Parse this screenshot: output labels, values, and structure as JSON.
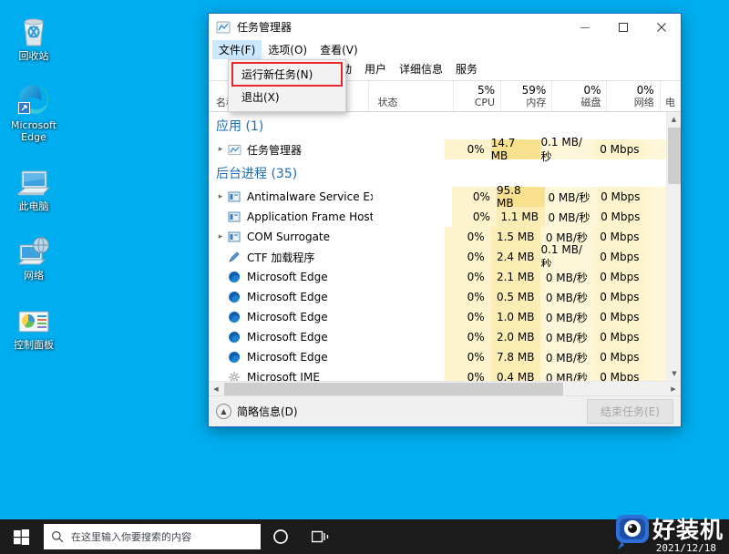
{
  "desktop": {
    "background_color": "#00AEF0",
    "icons": [
      {
        "label": "回收站",
        "icon": "recycle-bin-icon"
      },
      {
        "label": "Microsoft Edge",
        "icon": "edge-icon"
      },
      {
        "label": "此电脑",
        "icon": "this-pc-icon"
      },
      {
        "label": "网络",
        "icon": "network-icon"
      },
      {
        "label": "控制面板",
        "icon": "control-panel-icon"
      }
    ]
  },
  "window": {
    "title": "任务管理器",
    "icon": "task-manager-icon",
    "controls": {
      "minimize": "minimize-icon",
      "maximize": "maximize-icon",
      "close": "close-icon"
    },
    "menubar": [
      {
        "label": "文件(F)",
        "open": true
      },
      {
        "label": "选项(O)",
        "open": false
      },
      {
        "label": "查看(V)",
        "open": false
      }
    ],
    "file_menu": {
      "items": [
        {
          "label": "运行新任务(N)",
          "highlighted": true
        },
        {
          "label": "退出(X)",
          "highlighted": false
        }
      ],
      "highlight_color": "#e8262b"
    },
    "tabs": [
      {
        "label": "启动"
      },
      {
        "label": "用户"
      },
      {
        "label": "详细信息"
      },
      {
        "label": "服务"
      }
    ],
    "columns": [
      {
        "name": "名称",
        "pct": ""
      },
      {
        "name": "状态",
        "pct": ""
      },
      {
        "name": "CPU",
        "pct": "5%"
      },
      {
        "name": "内存",
        "pct": "59%"
      },
      {
        "name": "磁盘",
        "pct": "0%"
      },
      {
        "name": "网络",
        "pct": "0%"
      },
      {
        "name": "电",
        "pct": ""
      }
    ],
    "groups": [
      {
        "label": "应用 (1)"
      },
      {
        "label": "后台进程 (35)"
      }
    ],
    "rows": [
      {
        "name": "任务管理器",
        "icon": "task-manager-icon",
        "expander": true,
        "status": "",
        "cpu": "0%",
        "mem": "14.7 MB",
        "disk": "0.1 MB/秒",
        "net": "0 Mbps",
        "heat": true
      },
      {
        "name": "Antimalware Service Executa...",
        "icon": "generic-app-icon",
        "expander": true,
        "status": "",
        "cpu": "0%",
        "mem": "95.8 MB",
        "disk": "0 MB/秒",
        "net": "0 Mbps",
        "heat": true
      },
      {
        "name": "Application Frame Host",
        "icon": "generic-app-icon",
        "expander": false,
        "status": "",
        "cpu": "0%",
        "mem": "1.1 MB",
        "disk": "0 MB/秒",
        "net": "0 Mbps",
        "heat": false
      },
      {
        "name": "COM Surrogate",
        "icon": "generic-app-icon",
        "expander": true,
        "status": "",
        "cpu": "0%",
        "mem": "1.5 MB",
        "disk": "0 MB/秒",
        "net": "0 Mbps",
        "heat": false
      },
      {
        "name": "CTF 加载程序",
        "icon": "ctf-loader-icon",
        "expander": false,
        "status": "",
        "cpu": "0%",
        "mem": "2.4 MB",
        "disk": "0.1 MB/秒",
        "net": "0 Mbps",
        "heat": false
      },
      {
        "name": "Microsoft Edge",
        "icon": "edge-icon",
        "expander": false,
        "status": "",
        "cpu": "0%",
        "mem": "2.1 MB",
        "disk": "0 MB/秒",
        "net": "0 Mbps",
        "heat": false
      },
      {
        "name": "Microsoft Edge",
        "icon": "edge-icon",
        "expander": false,
        "status": "",
        "cpu": "0%",
        "mem": "0.5 MB",
        "disk": "0 MB/秒",
        "net": "0 Mbps",
        "heat": false
      },
      {
        "name": "Microsoft Edge",
        "icon": "edge-icon",
        "expander": false,
        "status": "",
        "cpu": "0%",
        "mem": "1.0 MB",
        "disk": "0 MB/秒",
        "net": "0 Mbps",
        "heat": false
      },
      {
        "name": "Microsoft Edge",
        "icon": "edge-icon",
        "expander": false,
        "status": "",
        "cpu": "0%",
        "mem": "2.0 MB",
        "disk": "0 MB/秒",
        "net": "0 Mbps",
        "heat": false
      },
      {
        "name": "Microsoft Edge",
        "icon": "edge-icon",
        "expander": false,
        "status": "",
        "cpu": "0%",
        "mem": "7.8 MB",
        "disk": "0 MB/秒",
        "net": "0 Mbps",
        "heat": false
      },
      {
        "name": "Microsoft IME",
        "icon": "ime-icon",
        "expander": false,
        "status": "",
        "cpu": "0%",
        "mem": "0.4 MB",
        "disk": "0 MB/秒",
        "net": "0 Mbps",
        "heat": false
      }
    ],
    "statusbar": {
      "fewer_details": "简略信息(D)",
      "end_task": "结束任务(E)"
    }
  },
  "taskbar": {
    "start": "windows-logo-icon",
    "search_placeholder": "在这里输入你要搜索的内容",
    "search_value": "",
    "buttons": [
      {
        "icon": "cortana-icon"
      },
      {
        "icon": "task-view-icon"
      }
    ]
  },
  "watermark": {
    "text": "好装机",
    "date": "2021/12/18"
  }
}
